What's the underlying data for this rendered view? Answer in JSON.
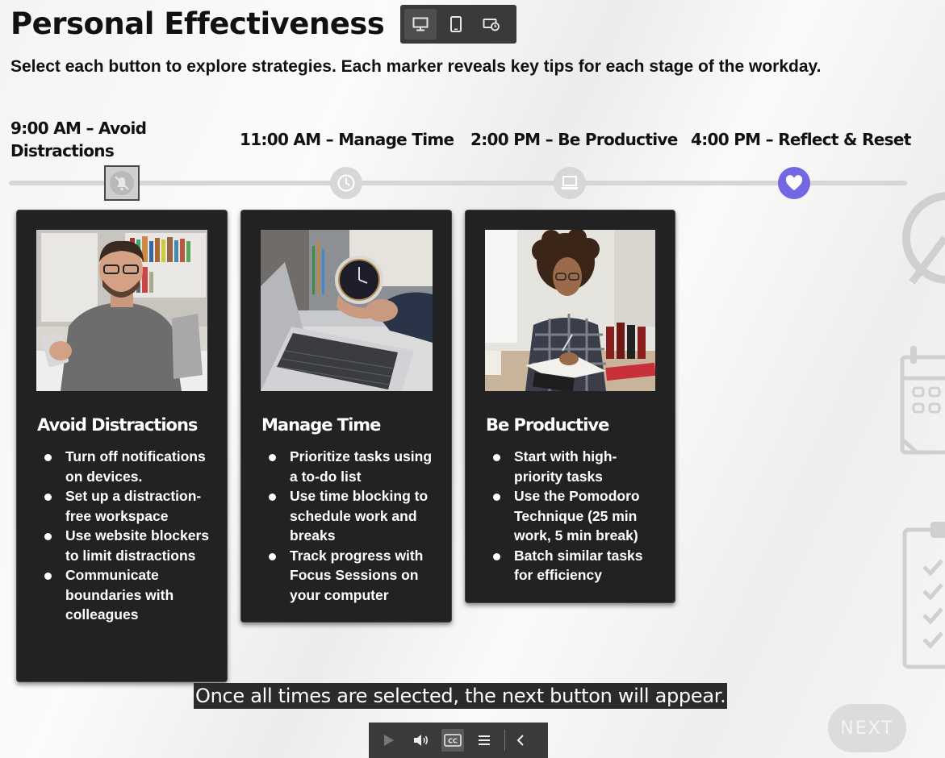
{
  "page": {
    "title": "Personal Effectiveness",
    "instructions": "Select each button to explore strategies. Each marker reveals key tips for each stage of the workday."
  },
  "view_switch": {
    "buttons": [
      {
        "icon": "desktop-icon",
        "active": true
      },
      {
        "icon": "tablet-icon",
        "active": false
      },
      {
        "icon": "rotate-device-icon",
        "active": false
      }
    ]
  },
  "timeline": {
    "labels": {
      "t1": "9:00 AM – Avoid Distractions",
      "t2": "11:00 AM – Manage Time",
      "t3": "2:00 PM – Be Productive",
      "t4": "4:00 PM – Reflect & Reset"
    },
    "markers": [
      {
        "icon": "notifications-off-icon",
        "state": "selected"
      },
      {
        "icon": "clock-icon",
        "state": "visited"
      },
      {
        "icon": "laptop-icon",
        "state": "visited"
      },
      {
        "icon": "heart-icon",
        "state": "unvisited"
      }
    ],
    "accent_color": "#7467e3"
  },
  "cards": {
    "c1": {
      "heading": "Avoid Distractions",
      "items": [
        "Turn off notifications on devices.",
        "Set up a distraction-free workspace",
        "Use website blockers to limit distractions",
        "Communicate boundaries with colleagues"
      ]
    },
    "c2": {
      "heading": "Manage Time",
      "items": [
        "Prioritize tasks using a to-do list",
        "Use time blocking to schedule work and breaks",
        "Track progress with Focus Sessions on your computer"
      ]
    },
    "c3": {
      "heading": "Be Productive",
      "items": [
        "Start with high-priority tasks",
        "Use the Pomodoro Technique (25 min work, 5 min break)",
        "Batch similar tasks for efficiency"
      ]
    }
  },
  "caption": "Once all times are selected, the next button will appear.",
  "player": {
    "controls": [
      "play-icon",
      "volume-icon",
      "closed-captions-icon",
      "menu-icon",
      "chevron-left-icon"
    ],
    "cc_label": "CC"
  },
  "next_button": {
    "label": "NEXT"
  }
}
